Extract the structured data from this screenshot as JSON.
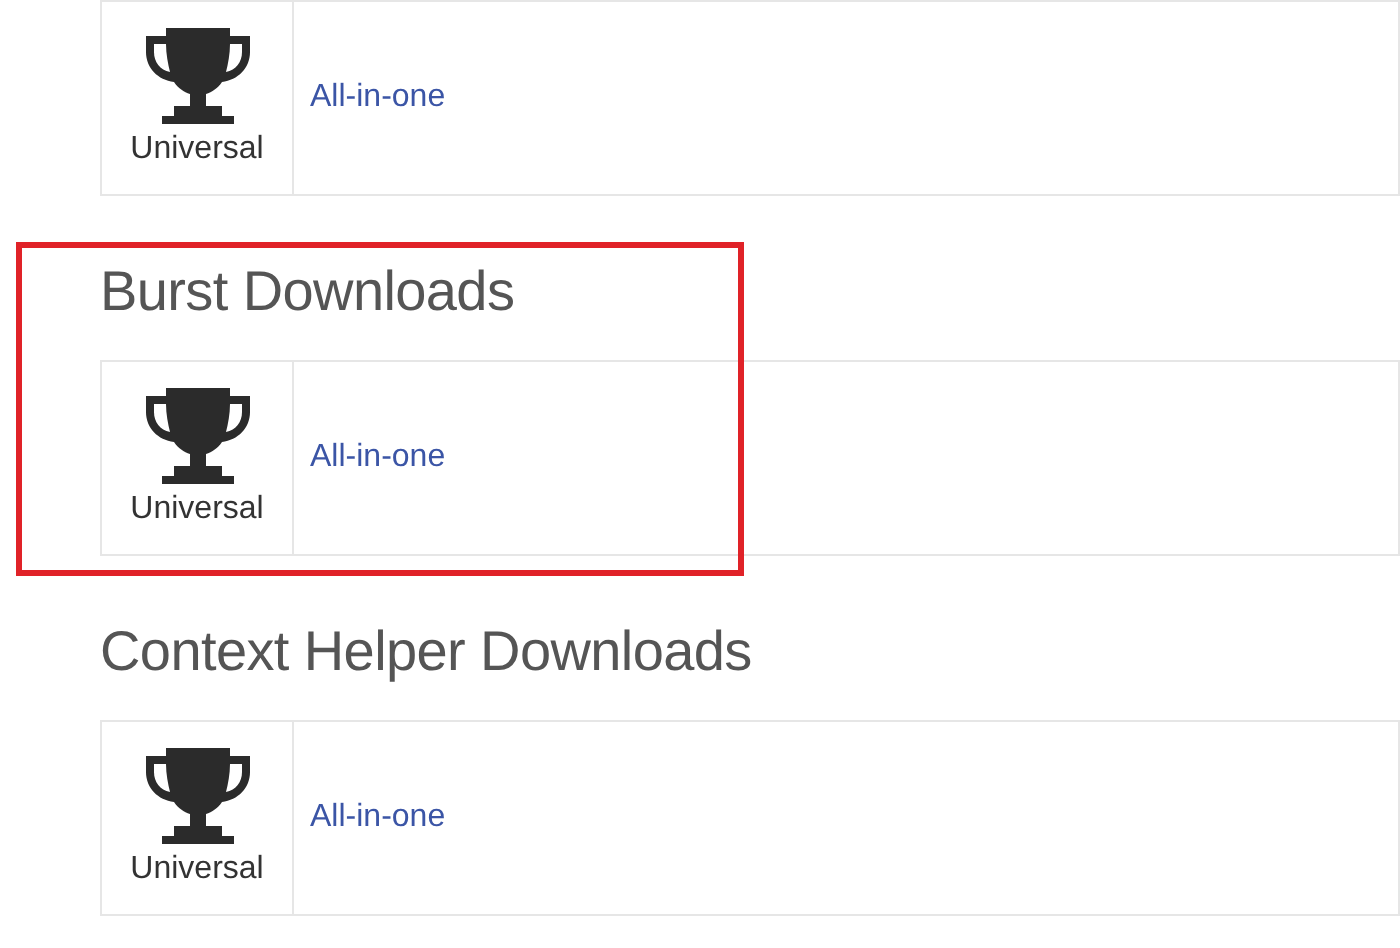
{
  "sections": [
    {
      "highlighted": false,
      "downloads": [
        {
          "platform": "Universal",
          "link": "All-in-one"
        }
      ]
    },
    {
      "heading": "Burst Downloads",
      "highlighted": true,
      "downloads": [
        {
          "platform": "Universal",
          "link": "All-in-one"
        }
      ]
    },
    {
      "heading": "Context Helper Downloads",
      "highlighted": false,
      "downloads": [
        {
          "platform": "Universal",
          "link": "All-in-one"
        }
      ]
    }
  ]
}
